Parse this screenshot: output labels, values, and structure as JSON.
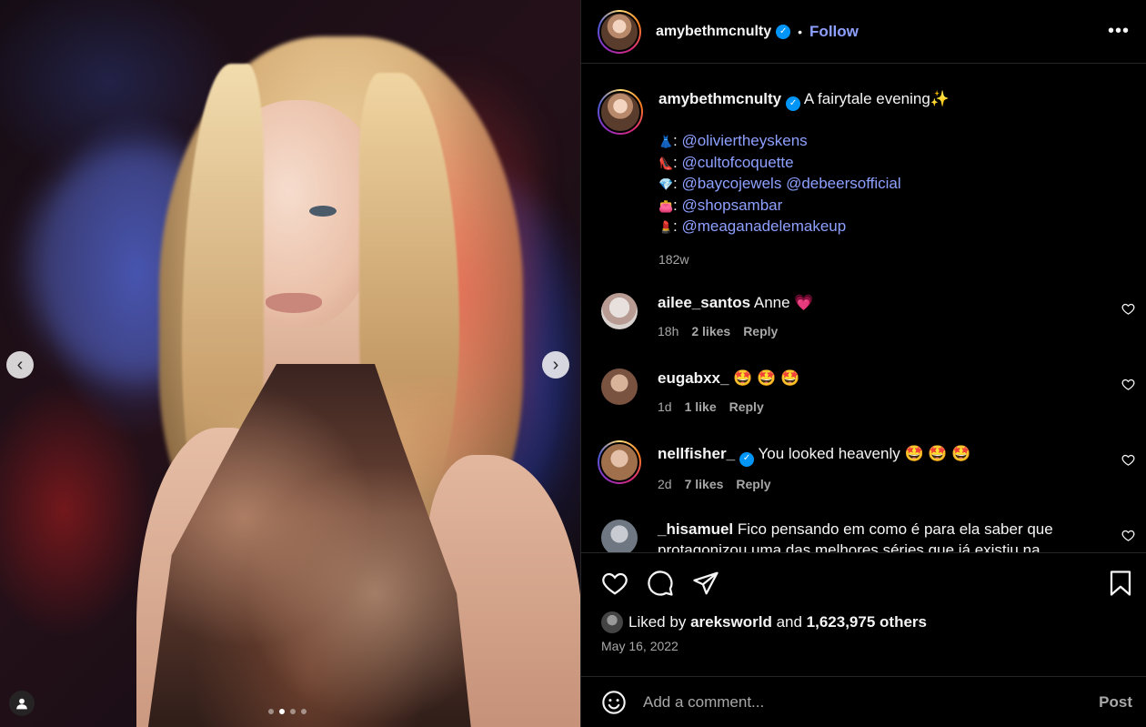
{
  "post": {
    "username": "amybethmcnulty",
    "follow_label": "Follow",
    "more_label": "•••",
    "separator": "•"
  },
  "caption": {
    "username": "amybethmcnulty",
    "text": "A fairytale evening✨",
    "credits": [
      {
        "emoji": "👗",
        "mentions": [
          "@oliviertheyskens"
        ]
      },
      {
        "emoji": "👠",
        "mentions": [
          "@cultofcoquette"
        ]
      },
      {
        "emoji": "💎",
        "mentions": [
          "@baycojewels",
          "@debeersofficial"
        ]
      },
      {
        "emoji": "👛",
        "mentions": [
          "@shopsambar"
        ]
      },
      {
        "emoji": "💄",
        "mentions": [
          "@meaganadelemakeup"
        ]
      }
    ],
    "time": "182w"
  },
  "comments": [
    {
      "username": "ailee_santos",
      "verified": false,
      "text": "Anne 💗",
      "time": "18h",
      "likes": "2 likes",
      "reply": "Reply"
    },
    {
      "username": "eugabxx_",
      "verified": false,
      "text": "🤩 🤩 🤩",
      "time": "1d",
      "likes": "1 like",
      "reply": "Reply"
    },
    {
      "username": "nellfisher_",
      "verified": true,
      "text": "You looked heavenly 🤩 🤩 🤩",
      "time": "2d",
      "likes": "7 likes",
      "reply": "Reply"
    },
    {
      "username": "_hisamuel",
      "verified": false,
      "text": "Fico pensando em como é para ela saber que protagonizou uma das melhores séries que já existiu na",
      "time": "",
      "likes": "",
      "reply": ""
    }
  ],
  "likes": {
    "prefix": "Liked by",
    "user": "areksworld",
    "and": "and",
    "count": "1,623,975 others"
  },
  "date": "May 16, 2022",
  "add_comment": {
    "placeholder": "Add a comment...",
    "post_label": "Post"
  },
  "carousel": {
    "prev_glyph": "‹",
    "next_glyph": "›",
    "slide_count": 4,
    "active_index": 1
  },
  "colors": {
    "accent": "#0095f6",
    "link": "#8ea0ff",
    "muted": "#a8a8a8",
    "like_red": "#ff3040"
  }
}
